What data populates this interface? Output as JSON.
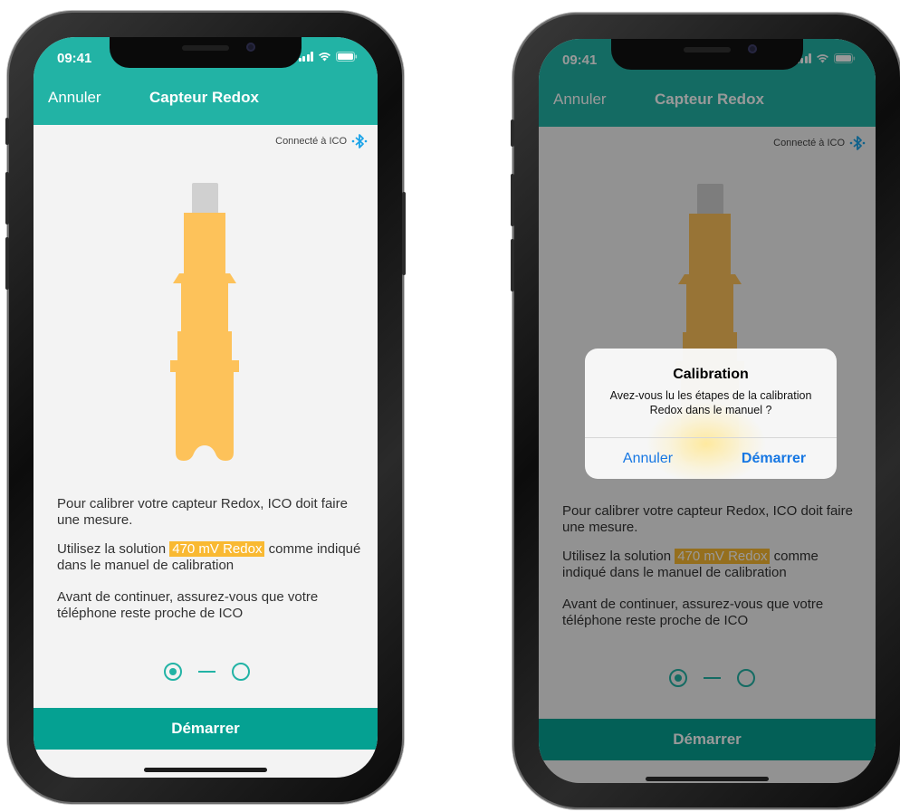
{
  "status": {
    "time": "09:41"
  },
  "nav": {
    "cancel_label": "Annuler",
    "title": "Capteur Redox"
  },
  "connection": {
    "label": "Connecté à ICO"
  },
  "instructions": {
    "p1": "Pour calibrer votre capteur Redox, ICO doit faire une mesure.",
    "p2_before": "Utilisez la solution ",
    "p2_highlight": "470 mV Redox",
    "p2_after": " comme indiqué dans le manuel de calibration",
    "p3": "Avant de continuer, assurez-vous que votre téléphone reste proche de ICO"
  },
  "stepper": {
    "total_steps": 2,
    "current_step": 1
  },
  "cta": {
    "start_label": "Démarrer"
  },
  "alert": {
    "title": "Calibration",
    "message": "Avez-vous lu les étapes de la calibration Redox dans le manuel ?",
    "cancel_label": "Annuler",
    "confirm_label": "Démarrer"
  },
  "colors": {
    "primary": "#22b3a5",
    "primary_dark": "#05a192",
    "highlight": "#f9b932",
    "sensor_body": "#fdc25a",
    "ios_blue": "#1677e3",
    "bluetooth": "#1aa3e8"
  },
  "icons": {
    "signal": "cellular-signal-icon",
    "wifi": "wifi-icon",
    "battery": "battery-icon",
    "bluetooth": "bluetooth-icon"
  }
}
